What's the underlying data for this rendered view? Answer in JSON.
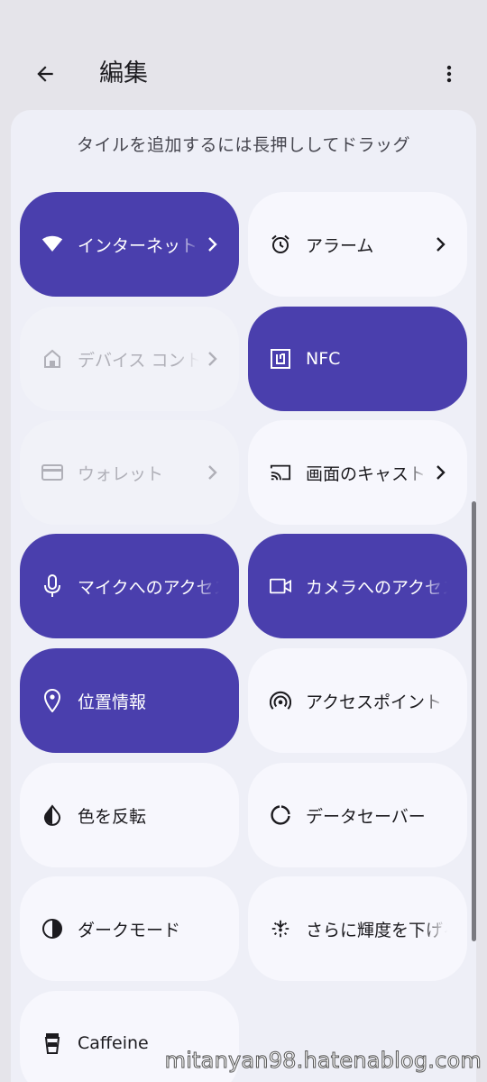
{
  "header": {
    "title": "編集"
  },
  "hint": "タイルを追加するには長押ししてドラッグ",
  "tiles": [
    {
      "label": "インターネット",
      "state": "active",
      "icon": "wifi-icon",
      "chevron": true
    },
    {
      "label": "アラーム",
      "state": "inactive",
      "icon": "alarm-icon",
      "chevron": true
    },
    {
      "label": "デバイス コントロール",
      "state": "disabled",
      "icon": "home-icon",
      "chevron": true
    },
    {
      "label": "NFC",
      "state": "active",
      "icon": "nfc-icon",
      "chevron": false
    },
    {
      "label": "ウォレット",
      "state": "disabled",
      "icon": "wallet-card-icon",
      "chevron": true
    },
    {
      "label": "画面のキャスト",
      "state": "inactive",
      "icon": "cast-icon",
      "chevron": true
    },
    {
      "label": "マイクへのアクセス",
      "state": "active",
      "icon": "microphone-icon",
      "chevron": false
    },
    {
      "label": "カメラへのアクセス",
      "state": "active",
      "icon": "camera-icon",
      "chevron": false
    },
    {
      "label": "位置情報",
      "state": "active",
      "icon": "location-pin-icon",
      "chevron": false
    },
    {
      "label": "アクセスポイント",
      "state": "inactive",
      "icon": "hotspot-icon",
      "chevron": false
    },
    {
      "label": "色を反転",
      "state": "inactive",
      "icon": "invert-colors-icon",
      "chevron": false
    },
    {
      "label": "データセーバー",
      "state": "inactive",
      "icon": "data-saver-icon",
      "chevron": false
    },
    {
      "label": "ダークモード",
      "state": "inactive",
      "icon": "dark-mode-icon",
      "chevron": false
    },
    {
      "label": "さらに輝度を下げる",
      "state": "inactive",
      "icon": "extra-dim-icon",
      "chevron": false
    },
    {
      "label": "Caffeine",
      "state": "inactive",
      "icon": "coffee-cup-icon",
      "chevron": false
    }
  ],
  "colors": {
    "active_tile": "#4a3fad",
    "inactive_tile": "#f7f7fd",
    "disabled_text": "#b0b0b8",
    "background": "#e5e4ea"
  },
  "watermark": "mitanyan98.hatenablog.com"
}
